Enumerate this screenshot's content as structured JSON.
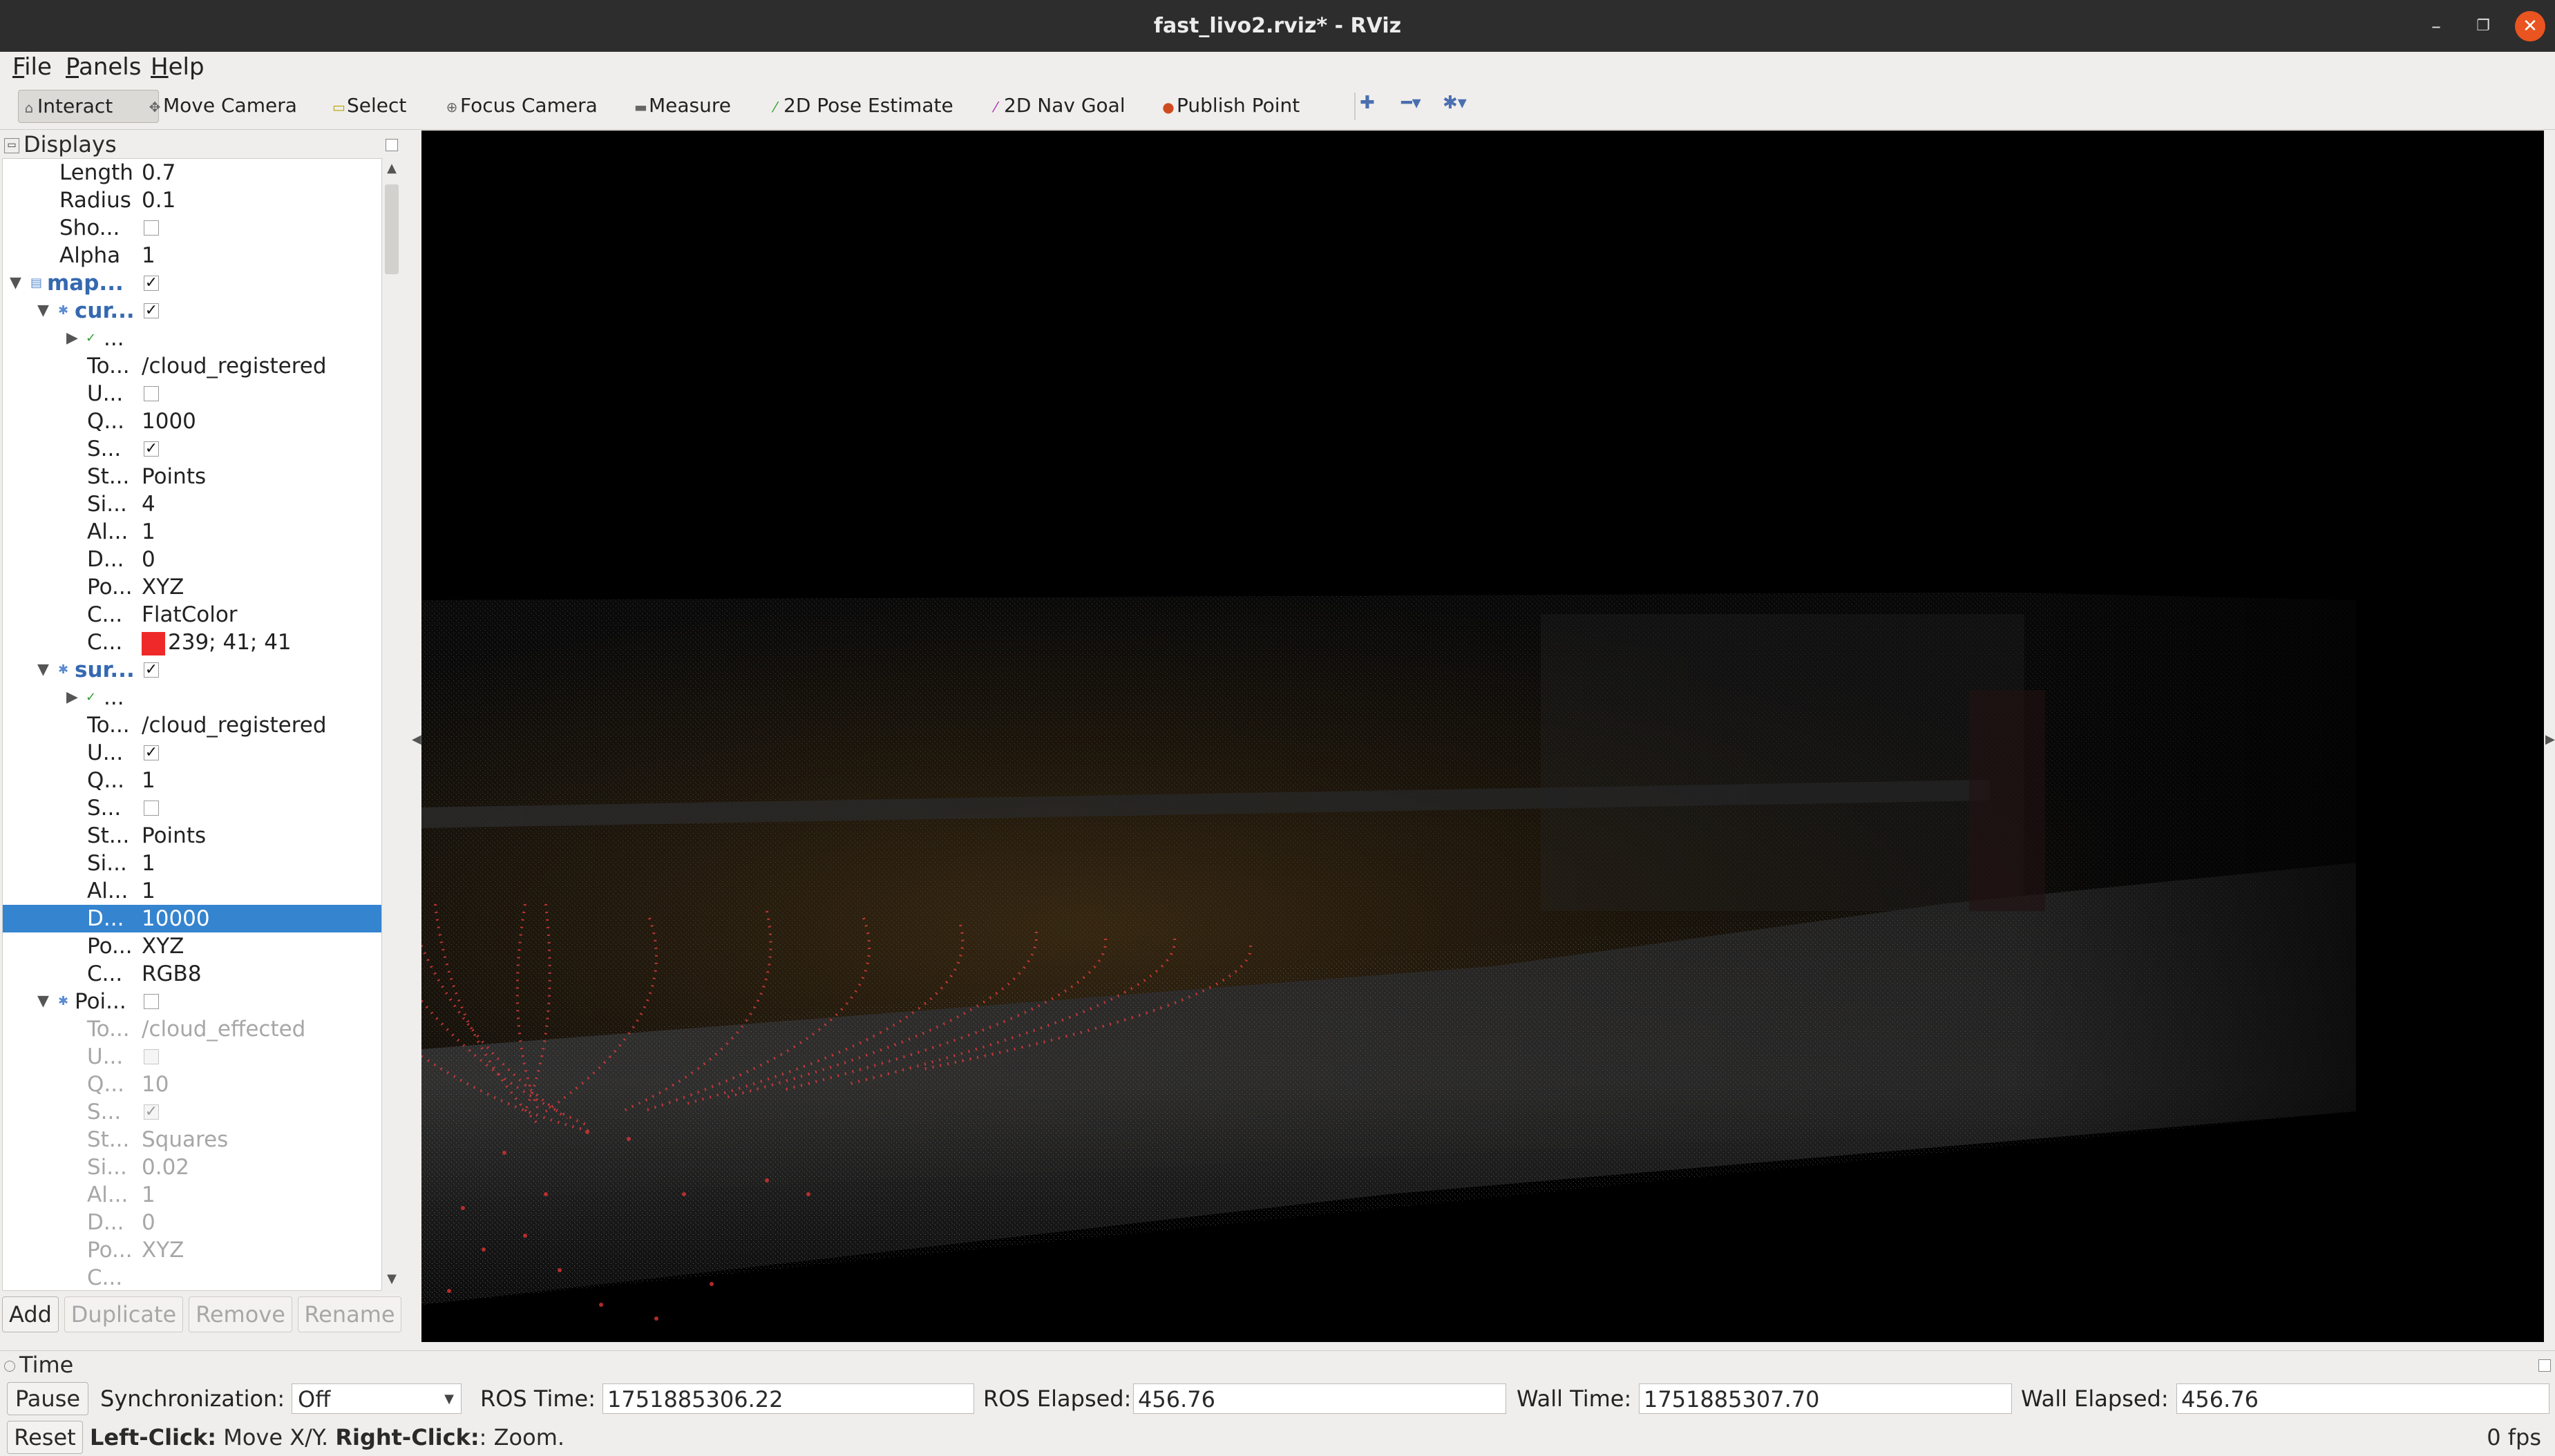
{
  "window": {
    "title": "fast_livo2.rviz* - RViz"
  },
  "menu": [
    "File",
    "Panels",
    "Help"
  ],
  "toolbar": {
    "interact": "Interact",
    "move_camera": "Move Camera",
    "select": "Select",
    "focus_camera": "Focus Camera",
    "measure": "Measure",
    "pose_estimate": "2D Pose Estimate",
    "nav_goal": "2D Nav Goal",
    "publish_point": "Publish Point"
  },
  "displays": {
    "header": "Displays",
    "rows": [
      {
        "key": "Length",
        "value": "0.7"
      },
      {
        "key": "Radius",
        "value": "0.1"
      },
      {
        "key": "Sho...",
        "check": false
      },
      {
        "key": "Alpha",
        "value": "1"
      },
      {
        "key": "map...",
        "check": true
      },
      {
        "key": "cur...",
        "check": true
      },
      {
        "key": "..."
      },
      {
        "key": "To...",
        "value": "/cloud_registered"
      },
      {
        "key": "U...",
        "check": false
      },
      {
        "key": "Q...",
        "value": "1000"
      },
      {
        "key": "S...",
        "check": true
      },
      {
        "key": "St...",
        "value": "Points"
      },
      {
        "key": "Si...",
        "value": "4"
      },
      {
        "key": "Al...",
        "value": "1"
      },
      {
        "key": "D...",
        "value": "0"
      },
      {
        "key": "Po...",
        "value": "XYZ"
      },
      {
        "key": "C...",
        "value": "FlatColor"
      },
      {
        "key": "C...",
        "value": "239; 41; 41",
        "swatch": "#ef2929"
      },
      {
        "key": "sur...",
        "check": true
      },
      {
        "key": "..."
      },
      {
        "key": "To...",
        "value": "/cloud_registered"
      },
      {
        "key": "U...",
        "check": true
      },
      {
        "key": "Q...",
        "value": "1"
      },
      {
        "key": "S...",
        "check": false
      },
      {
        "key": "St...",
        "value": "Points"
      },
      {
        "key": "Si...",
        "value": "1"
      },
      {
        "key": "Al...",
        "value": "1"
      },
      {
        "key": "D...",
        "value": "10000"
      },
      {
        "key": "Po...",
        "value": "XYZ"
      },
      {
        "key": "C...",
        "value": "RGB8"
      },
      {
        "key": "Poi...",
        "check": false
      },
      {
        "key": "To...",
        "value": "/cloud_effected"
      },
      {
        "key": "U...",
        "check": false
      },
      {
        "key": "Q...",
        "value": "10"
      },
      {
        "key": "S...",
        "check": true
      },
      {
        "key": "St...",
        "value": "Squares"
      },
      {
        "key": "Si...",
        "value": "0.02"
      },
      {
        "key": "Al...",
        "value": "1"
      },
      {
        "key": "D...",
        "value": "0"
      },
      {
        "key": "Po...",
        "value": "XYZ"
      },
      {
        "key": "C..."
      }
    ],
    "buttons": {
      "add": "Add",
      "duplicate": "Duplicate",
      "remove": "Remove",
      "rename": "Rename"
    }
  },
  "time": {
    "header": "Time",
    "pause": "Pause",
    "sync_label": "Synchronization:",
    "sync_value": "Off",
    "ros_time_label": "ROS Time:",
    "ros_time": "1751885306.22",
    "ros_elapsed_label": "ROS Elapsed:",
    "ros_elapsed": "456.76",
    "wall_time_label": "Wall Time:",
    "wall_time": "1751885307.70",
    "wall_elapsed_label": "Wall Elapsed:",
    "wall_elapsed": "456.76"
  },
  "status": {
    "reset": "Reset",
    "left_click": "Left-Click:",
    "left_action": " Move X/Y. ",
    "right_click": "Right-Click:",
    "right_action": ": Zoom.",
    "fps": "0 fps"
  }
}
